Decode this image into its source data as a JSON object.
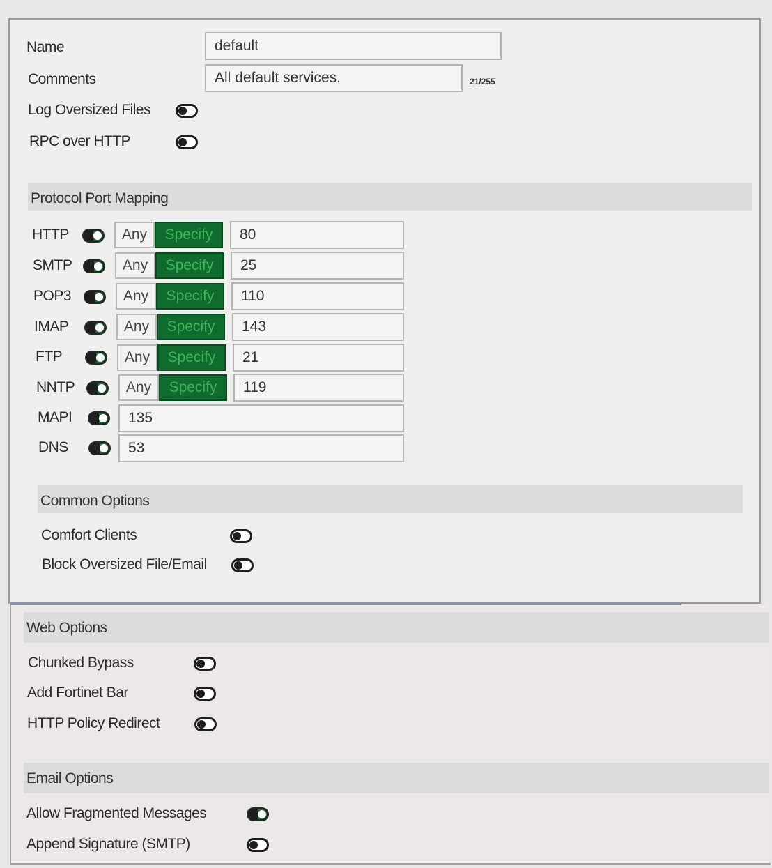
{
  "general": {
    "name_label": "Name",
    "name_value": "default",
    "comments_label": "Comments",
    "comments_value": "All default services.",
    "comments_counter": "21/255",
    "log_oversized_label": "Log Oversized Files",
    "log_oversized_on": false,
    "rpc_over_http_label": "RPC over HTTP",
    "rpc_over_http_on": false
  },
  "protocol_port_mapping": {
    "title": "Protocol Port Mapping",
    "any_label": "Any",
    "specify_label": "Specify",
    "rows": [
      {
        "protocol": "HTTP",
        "enabled": true,
        "mode": "Specify",
        "port": "80"
      },
      {
        "protocol": "SMTP",
        "enabled": true,
        "mode": "Specify",
        "port": "25"
      },
      {
        "protocol": "POP3",
        "enabled": true,
        "mode": "Specify",
        "port": "110"
      },
      {
        "protocol": "IMAP",
        "enabled": true,
        "mode": "Specify",
        "port": "143"
      },
      {
        "protocol": "FTP",
        "enabled": true,
        "mode": "Specify",
        "port": "21"
      },
      {
        "protocol": "NNTP",
        "enabled": true,
        "mode": "Specify",
        "port": "119"
      },
      {
        "protocol": "MAPI",
        "enabled": true,
        "port": "135"
      },
      {
        "protocol": "DNS",
        "enabled": true,
        "port": "53"
      }
    ]
  },
  "common_options": {
    "title": "Common Options",
    "comfort_clients_label": "Comfort Clients",
    "comfort_clients_on": false,
    "block_oversized_label": "Block Oversized File/Email",
    "block_oversized_on": false
  },
  "web_options": {
    "title": "Web Options",
    "chunked_bypass_label": "Chunked Bypass",
    "chunked_bypass_on": false,
    "add_fortinet_bar_label": "Add Fortinet Bar",
    "add_fortinet_bar_on": false,
    "http_policy_redirect_label": "HTTP Policy Redirect",
    "http_policy_redirect_on": false
  },
  "email_options": {
    "title": "Email Options",
    "allow_fragmented_label": "Allow Fragmented Messages",
    "allow_fragmented_on": true,
    "append_signature_label": "Append Signature (SMTP)",
    "append_signature_on": false
  },
  "colors": {
    "accent_green": "#0f6b2e",
    "toggle_on": "#1f6b34",
    "section_band": "#dcdcdc"
  }
}
